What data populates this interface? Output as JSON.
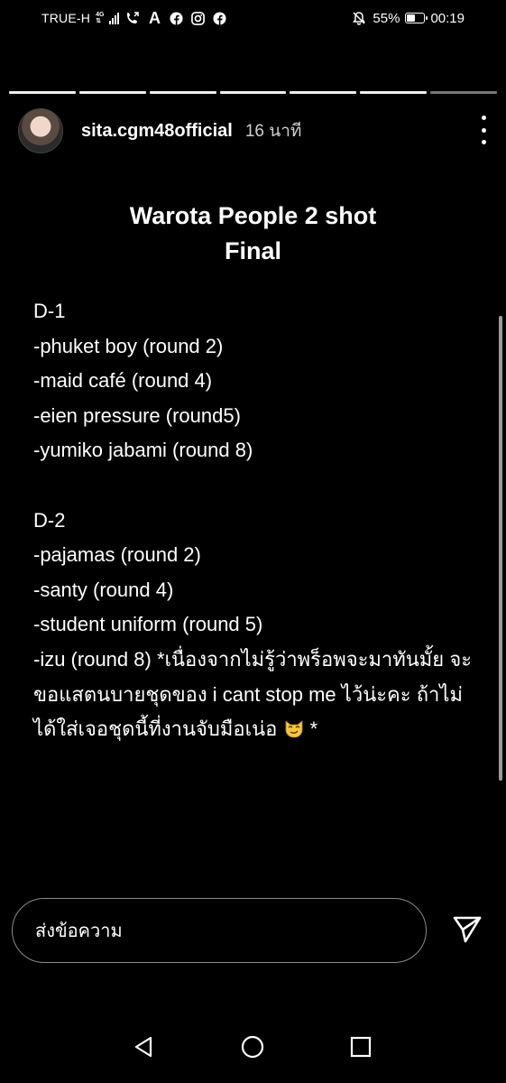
{
  "status_bar": {
    "carrier": "TRUE-H",
    "network": "4G",
    "battery_percent": "55%",
    "battery_level": 0.55,
    "time": "00:19"
  },
  "story": {
    "segments_total": 7,
    "current_segment": 7,
    "username": "sita.cgm48official",
    "posted_time": "16 นาที",
    "title_line1": "Warota People 2 shot",
    "title_line2": "Final",
    "day1": {
      "label": "D-1",
      "items": [
        "-phuket boy (round 2)",
        "-maid café (round 4)",
        "-eien pressure (round5)",
        "-yumiko jabami (round 8)"
      ]
    },
    "day2": {
      "label": "D-2",
      "items": [
        "-pajamas (round 2)",
        "-santy (round 4)",
        "-student uniform (round 5)"
      ],
      "last_item": "-izu (round 8) *เนื่องจากไม่รู้ว่าพร็อพจะมาทันมั้ย จะขอแสตนบายชุดของ i cant stop me ไว้น่ะคะ ถ้าไม่ได้ใส่เจอชุดนี้ที่งานจับมือเน่อ",
      "last_item_suffix": "*"
    }
  },
  "message_bar": {
    "placeholder": "ส่งข้อความ"
  },
  "icons": {
    "more": "more-vertical-icon",
    "send": "send-icon",
    "emoji": "smirking-cat-emoji",
    "nav_back": "back-triangle-icon",
    "nav_home": "home-circle-icon",
    "nav_recents": "recents-square-icon"
  }
}
